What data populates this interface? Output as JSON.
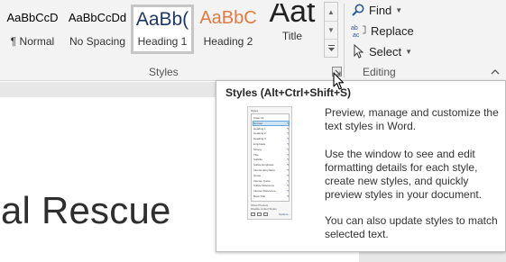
{
  "ribbon": {
    "styles_group": {
      "label": "Styles",
      "gallery": [
        {
          "preview": "AaBbCcD",
          "name": "¶ Normal"
        },
        {
          "preview": "AaBbCcDd",
          "name": "No Spacing"
        },
        {
          "preview": "AaBb(",
          "name": "Heading 1"
        },
        {
          "preview": "AaBbC",
          "name": "Heading 2"
        },
        {
          "preview": "Aat",
          "name": "Title"
        }
      ],
      "selected": "Heading 1"
    },
    "editing_group": {
      "label": "Editing",
      "find_label": "Find",
      "replace_label": "Replace",
      "select_label": "Select"
    }
  },
  "document": {
    "visible_text": "al Rescue"
  },
  "tooltip": {
    "title": "Styles (Alt+Ctrl+Shift+S)",
    "paragraph1": "Preview, manage and customize the text styles in Word.",
    "paragraph2": "Use the window to see and edit formatting details for each style, create new styles, and quickly preview styles in your document.",
    "paragraph3": "You can also update styles to match selected text.",
    "thumbnail": {
      "pane_title": "Styles",
      "rows": [
        "Clear All",
        "Normal",
        "Heading 1",
        "Heading 2",
        "Heading 3",
        "Emphasis",
        "Strong",
        "Title",
        "Subtitle",
        "Subtle Emphasis",
        "Intense Emphasis",
        "Quote",
        "Intense Quote",
        "Subtle Reference",
        "Intense Reference",
        "Book Title"
      ],
      "checkbox1": "Show Preview",
      "checkbox2": "Disable Linked Styles",
      "options_link": "Options..."
    }
  },
  "colors": {
    "ribbon_bg": "#f3f3f3",
    "heading1_text": "#1f3864",
    "heading2_text": "#e07a42",
    "accent_blue": "#2b5797"
  },
  "icons": {
    "find": "binoculars-search-icon",
    "replace": "replace-ab-icon",
    "select": "cursor-select-icon",
    "dialog_launcher": "dialog-launcher-icon",
    "collapse": "chevron-up-icon",
    "pointer": "mouse-pointer-icon"
  }
}
